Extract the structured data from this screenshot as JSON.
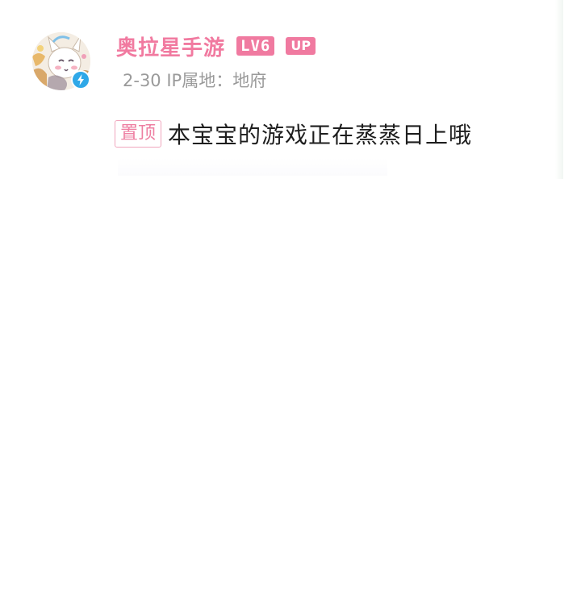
{
  "comment": {
    "username": "奥拉星手游",
    "level_badge": "LV6",
    "up_badge": "UP",
    "meta": "2-30 IP属地：地府",
    "pin_tag": "置顶",
    "text": "本宝宝的游戏正在蒸蒸日上哦"
  },
  "colors": {
    "brand_pink": "#f17aa0",
    "meta_gray": "#9a9a9a",
    "text_dark": "#1e1e1e",
    "verify_blue": "#2fa8e8"
  },
  "icons": {
    "avatar": "cartoon-character-avatar",
    "verify": "lightning-verify-icon"
  }
}
